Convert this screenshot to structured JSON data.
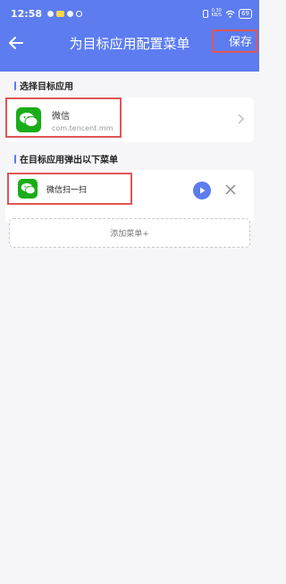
{
  "status_bar": {
    "time": "12:58",
    "speed": "0.30\nKB/S",
    "battery": "69"
  },
  "toolbar": {
    "title": "为目标应用配置菜单",
    "save_label": "保存"
  },
  "target_section": {
    "title": "选择目标应用",
    "app": {
      "name": "微信",
      "package": "com.tencent.mm"
    }
  },
  "menu_section": {
    "title": "在目标应用弹出以下菜单",
    "items": [
      {
        "label": "微信扫一扫"
      }
    ],
    "add_label": "添加菜单+"
  },
  "colors": {
    "accent": "#5c7cf0",
    "wechat_green": "#1aad19",
    "highlight": "#e05656",
    "background": "#f6f6f8"
  }
}
